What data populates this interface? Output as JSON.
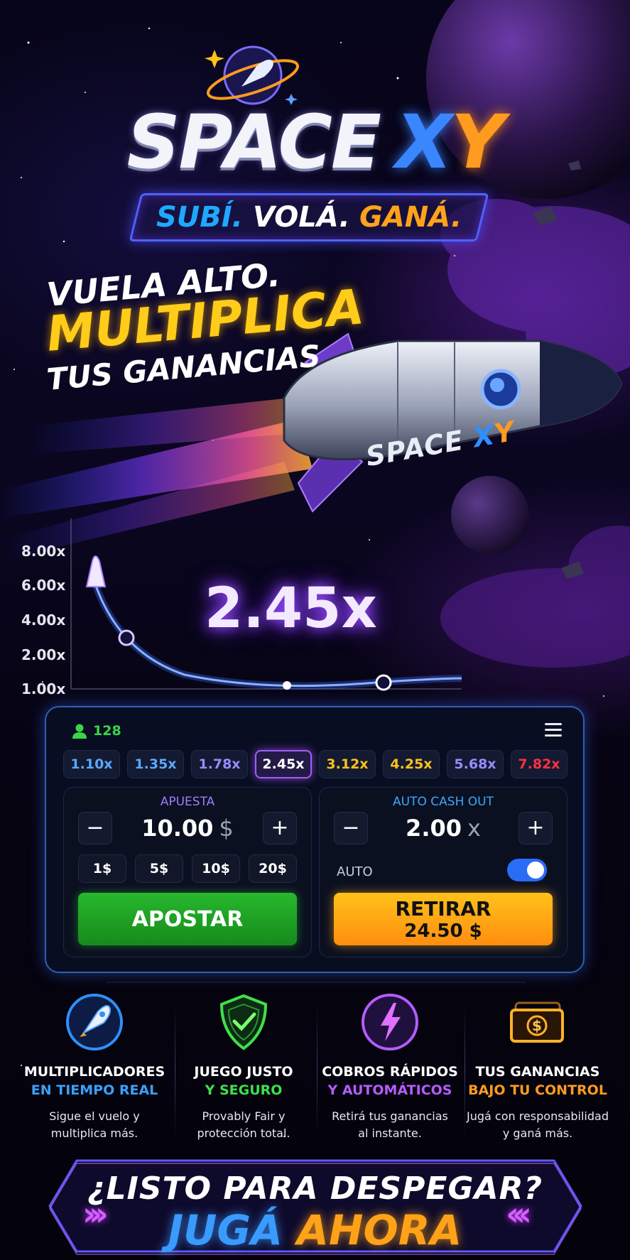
{
  "header": {
    "logo_word1": "SPACE",
    "logo_word2_a": "X",
    "logo_word2_b": "Y",
    "tagline": [
      "SUBÍ.",
      "VOLÁ.",
      "GANÁ."
    ]
  },
  "hero": {
    "line1": "VUELA ALTO.",
    "line2": "MULTIPLICA",
    "line3": "TUS GANANCIAS",
    "ship_label_a": "SPACE ",
    "ship_label_b": "X",
    "ship_label_c": "Y"
  },
  "graph": {
    "y_ticks": [
      "8.00x",
      "6.00x",
      "4.00x",
      "2.00x",
      "1.00x"
    ],
    "current_multiplier": "2.45x"
  },
  "panel": {
    "players_count": "128",
    "history": [
      {
        "label": "1.10x",
        "color": "#5aa9ff"
      },
      {
        "label": "1.35x",
        "color": "#5aa9ff"
      },
      {
        "label": "1.78x",
        "color": "#9a8cff"
      },
      {
        "label": "2.45x",
        "color": "#ffffff"
      },
      {
        "label": "3.12x",
        "color": "#ffc21a"
      },
      {
        "label": "4.25x",
        "color": "#ffc21a"
      },
      {
        "label": "5.68x",
        "color": "#9a8cff"
      },
      {
        "label": "7.82x",
        "color": "#ff3040"
      }
    ],
    "bet": {
      "title": "APUESTA",
      "value": "10.00",
      "unit": "$",
      "quick": [
        "1$",
        "5$",
        "10$",
        "20$"
      ],
      "button": "APOSTAR"
    },
    "auto": {
      "title": "AUTO CASH OUT",
      "value": "2.00",
      "unit": "x",
      "auto_label": "AUTO",
      "auto_enabled": true,
      "button_line1": "RETIRAR",
      "button_line2": "24.50 $"
    }
  },
  "features": [
    {
      "icon": "rocket-icon",
      "h1": "MULTIPLICADORES",
      "h2": "EN TIEMPO REAL",
      "h2_color": "#3aa0ff",
      "d1": "Sigue el vuelo y",
      "d2": "multiplica más."
    },
    {
      "icon": "shield-check-icon",
      "h1": "JUEGO JUSTO",
      "h2": "Y SEGURO",
      "h2_color": "#3fe04a",
      "d1": "Provably Fair y",
      "d2": "protección total."
    },
    {
      "icon": "lightning-icon",
      "h1": "COBROS RÁPIDOS",
      "h2": "Y AUTOMÁTICOS",
      "h2_color": "#b45cff",
      "d1": "Retirá tus ganancias",
      "d2": "al instante."
    },
    {
      "icon": "money-icon",
      "h1": "TUS GANANCIAS",
      "h2": "BAJO TU CONTROL",
      "h2_color": "#ff9b1f",
      "d1": "Jugá con responsabilidad",
      "d2": "y ganá más."
    }
  ],
  "cta": {
    "question": "¿LISTO PARA DESPEGAR?",
    "go_a": "JUGÁ",
    "go_b": "AHORA"
  },
  "colors": {
    "accent_blue": "#3a86ff",
    "accent_orange": "#ff9b1f",
    "accent_purple": "#a45cff",
    "bet_green": "#28b82d",
    "cash_orange": "#ffa21a"
  }
}
